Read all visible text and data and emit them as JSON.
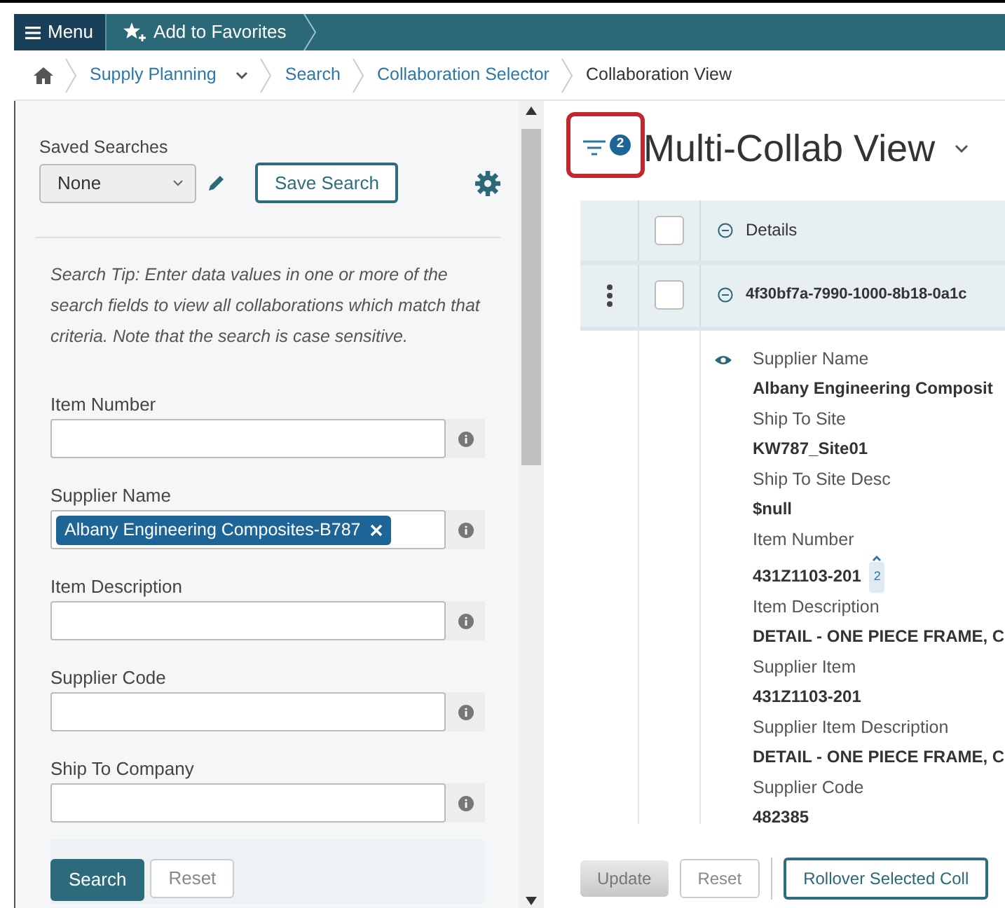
{
  "topbar": {
    "menu": "Menu",
    "favorites": "Add to Favorites"
  },
  "breadcrumbs": [
    {
      "label": "Supply Planning",
      "kind": "link",
      "dropdown": true
    },
    {
      "label": "Search",
      "kind": "link",
      "dropdown": false
    },
    {
      "label": "Collaboration Selector",
      "kind": "link",
      "dropdown": false
    },
    {
      "label": "Collaboration View",
      "kind": "current",
      "dropdown": false
    }
  ],
  "search_panel": {
    "saved_searches_label": "Saved Searches",
    "saved_search_value": "None",
    "save_button": "Save Search",
    "tip": "Search Tip: Enter data values in one or more of the search fields to view all collaborations which match that criteria. Note that the search is case sensitive.",
    "fields": [
      {
        "label": "Item Number"
      },
      {
        "label": "Supplier Name",
        "tags": [
          "Albany Engineering Composites-B787"
        ]
      },
      {
        "label": "Item Description"
      },
      {
        "label": "Supplier Code"
      },
      {
        "label": "Ship To Company"
      }
    ],
    "search_button": "Search",
    "reset_button": "Reset"
  },
  "view": {
    "filter_count": "2",
    "title": "Multi-Collab View",
    "header_label": "Details",
    "header_checked": false,
    "row": {
      "id": "4f30bf7a-7990-1000-8b18-0a1c",
      "checked": false
    },
    "details": [
      {
        "label": "Supplier Name",
        "value": "Albany Engineering Composit"
      },
      {
        "label": "Ship To Site",
        "value": "KW787_Site01"
      },
      {
        "label": "Ship To Site Desc",
        "value": "$null"
      },
      {
        "label": "Item Number",
        "value": "431Z1103-201",
        "badge": "2"
      },
      {
        "label": "Item Description",
        "value": "DETAIL - ONE PIECE FRAME, C"
      },
      {
        "label": "Supplier Item",
        "value": "431Z1103-201"
      },
      {
        "label": "Supplier Item Description",
        "value": "DETAIL - ONE PIECE FRAME, C"
      },
      {
        "label": "Supplier Code",
        "value": "482385"
      }
    ]
  },
  "footer_buttons": [
    {
      "label": "Update",
      "kind": "disabled"
    },
    {
      "label": "Reset",
      "kind": "plain"
    },
    {
      "label": "Rollover Selected Coll",
      "kind": "primary"
    }
  ]
}
